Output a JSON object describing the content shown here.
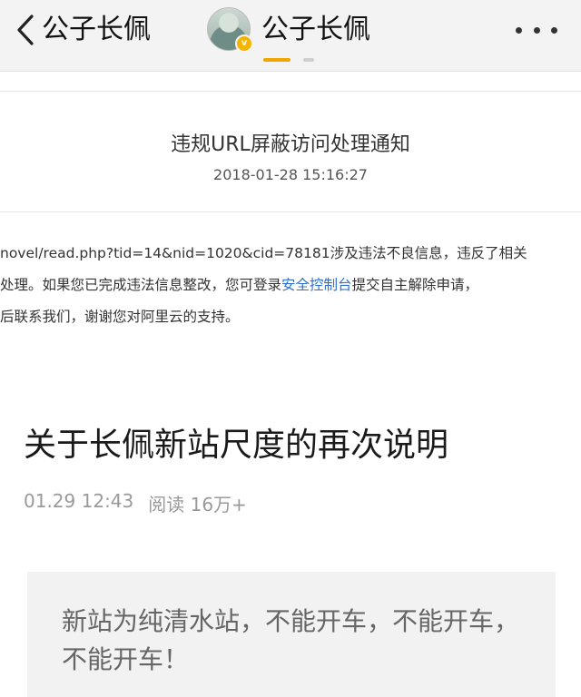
{
  "nav": {
    "back_label": "公子长佩",
    "account_name": "公子长佩",
    "verified_badge": "v",
    "accent_color": "#f0a500",
    "icons": {
      "back": "chevron-left-icon",
      "more": "more-dots-icon",
      "avatar": "avatar"
    }
  },
  "notice": {
    "title": "违规URL屏蔽访问处理通知",
    "time": "2018-01-28 15:16:27",
    "line1": "novel/read.php?tid=14&nid=1020&cid=78181涉及违法不良信息，违反了相关",
    "line2_pre": "处理。如果您已完成违法信息整改，您可登录",
    "line2_link": "安全控制台",
    "line2_post": "提交自主解除申请，",
    "line3": "后联系我们，谢谢您对阿里云的支持。",
    "link_color": "#2f6fcf"
  },
  "article": {
    "title": "关于长佩新站尺度的再次说明",
    "date": "01.29 12:43",
    "reads": "阅读 16万+",
    "quote": "新站为纯清水站，不能开车，不能开车，不能开车！"
  }
}
